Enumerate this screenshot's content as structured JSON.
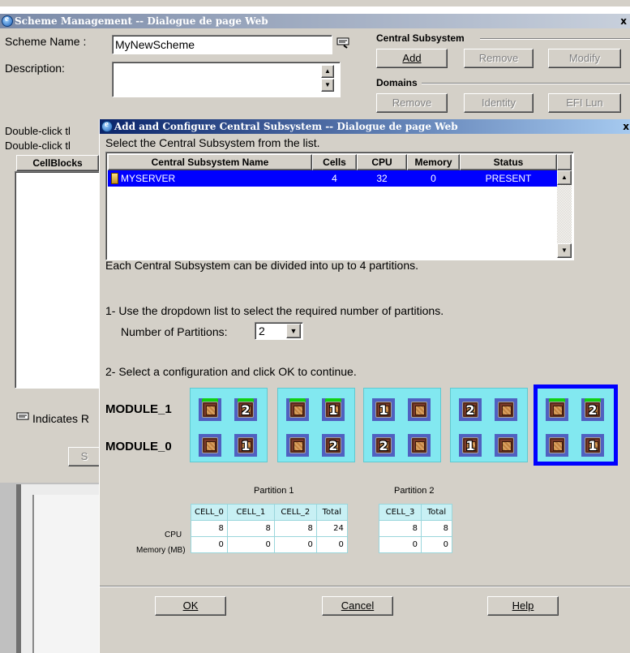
{
  "outer_window": {
    "title": "Scheme Management -- Dialogue de page Web",
    "close_glyph": "x",
    "scheme_name_label": "Scheme Name :",
    "scheme_name_value": "MyNewScheme",
    "description_label": "Description:",
    "description_value": "",
    "central_subsystem_group": "Central Subsystem",
    "add_label": "Add",
    "remove_label": "Remove",
    "modify_label": "Modify",
    "domains_group": "Domains",
    "domains_remove_label": "Remove",
    "identity_label": "Identity",
    "efi_lun_label": "EFI Lun",
    "double_click_1": "Double-click tl",
    "double_click_2": "Double-click tl",
    "cellblocks_header": "CellBlocks",
    "indicates_label": "Indicates R",
    "partial_button": "S"
  },
  "dialog": {
    "title": "Add and Configure Central Subsystem -- Dialogue de page Web",
    "close_glyph": "x",
    "select_instruction": "Select the Central Subsystem from the list.",
    "table": {
      "columns": [
        "Central Subsystem Name",
        "Cells",
        "CPU",
        "Memory",
        "Status"
      ],
      "rows": [
        [
          "MYSERVER",
          "4",
          "32",
          "0",
          "PRESENT"
        ]
      ]
    },
    "partitions_info": "Each Central Subsystem can be divided into up to 4 partitions.",
    "step1": "1- Use the dropdown list to select the required number of partitions.",
    "num_partitions_label": "Number of Partitions:",
    "num_partitions_value": "2",
    "step2": "2- Select a configuration and click OK to continue.",
    "module_1_label": "MODULE_1",
    "module_0_label": "MODULE_0",
    "configurations": [
      {
        "module_1": [
          "",
          "2"
        ],
        "module_0": [
          "",
          "1"
        ],
        "selected": false
      },
      {
        "module_1": [
          "",
          "1"
        ],
        "module_0": [
          "",
          "2"
        ],
        "selected": false
      },
      {
        "module_1": [
          "1",
          ""
        ],
        "module_0": [
          "2",
          ""
        ],
        "selected": false
      },
      {
        "module_1": [
          "2",
          ""
        ],
        "module_0": [
          "1",
          ""
        ],
        "selected": false
      },
      {
        "module_1": [
          "",
          "2"
        ],
        "module_0": [
          "",
          "1"
        ],
        "selected": true
      }
    ],
    "partition1": {
      "title": "Partition 1",
      "columns": [
        "CELL_0",
        "CELL_1",
        "CELL_2",
        "Total"
      ],
      "cpu": [
        "8",
        "8",
        "8",
        "24"
      ],
      "memory": [
        "0",
        "0",
        "0",
        "0"
      ]
    },
    "partition2": {
      "title": "Partition 2",
      "columns": [
        "CELL_3",
        "Total"
      ],
      "cpu": [
        "8",
        "8"
      ],
      "memory": [
        "0",
        "0"
      ]
    },
    "row_cpu_label": "CPU",
    "row_memory_label": "Memory (MB)",
    "ok_label": "OK",
    "cancel_label": "Cancel",
    "help_label": "Help"
  },
  "colors": {
    "titlebar_start": "#0a246a",
    "titlebar_end": "#a6caf0",
    "selection": "#0000ff",
    "config_bg": "#82e8f0",
    "selected_border": "#0000ff"
  }
}
